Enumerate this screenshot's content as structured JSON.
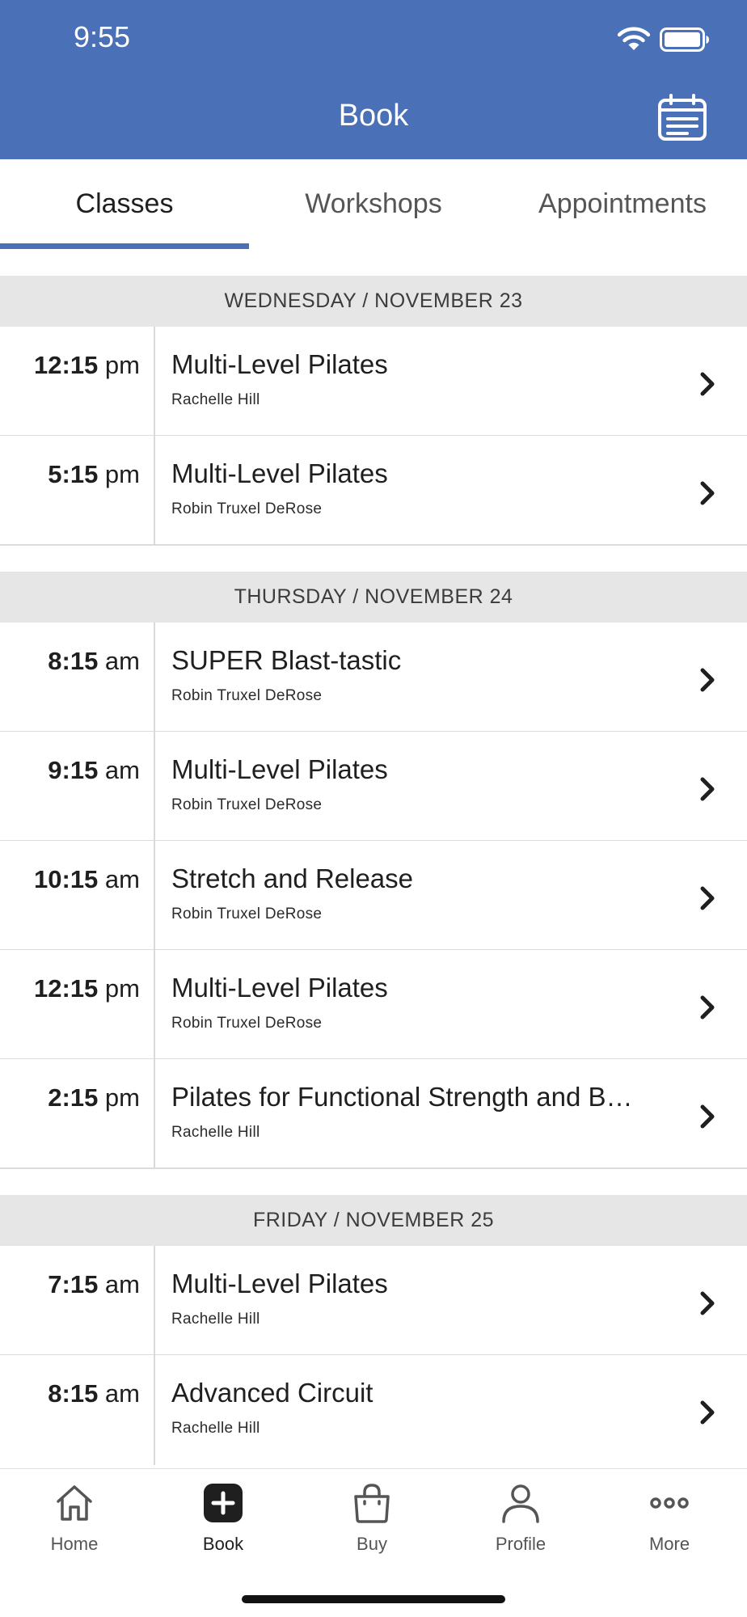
{
  "status_bar": {
    "time": "9:55"
  },
  "header": {
    "title": "Book"
  },
  "tabs": [
    {
      "label": "Classes",
      "active": true
    },
    {
      "label": "Workshops",
      "active": false
    },
    {
      "label": "Appointments",
      "active": false
    }
  ],
  "sections": [
    {
      "header": "WEDNESDAY / NOVEMBER 23",
      "rows": [
        {
          "time": "12:15",
          "ampm": " pm",
          "title": "Multi-Level Pilates",
          "instructor": "Rachelle Hill"
        },
        {
          "time": "5:15",
          "ampm": " pm",
          "title": "Multi-Level Pilates",
          "instructor": "Robin Truxel DeRose"
        }
      ]
    },
    {
      "header": "THURSDAY / NOVEMBER 24",
      "rows": [
        {
          "time": "8:15",
          "ampm": " am",
          "title": "SUPER Blast-tastic",
          "instructor": "Robin Truxel DeRose"
        },
        {
          "time": "9:15",
          "ampm": " am",
          "title": "Multi-Level Pilates",
          "instructor": "Robin Truxel DeRose"
        },
        {
          "time": "10:15",
          "ampm": " am",
          "title": "Stretch and Release",
          "instructor": "Robin Truxel DeRose"
        },
        {
          "time": "12:15",
          "ampm": " pm",
          "title": "Multi-Level Pilates",
          "instructor": "Robin Truxel DeRose"
        },
        {
          "time": "2:15",
          "ampm": " pm",
          "title": "Pilates for Functional Strength and B…",
          "instructor": "Rachelle Hill"
        }
      ]
    },
    {
      "header": "FRIDAY / NOVEMBER 25",
      "rows": [
        {
          "time": "7:15",
          "ampm": " am",
          "title": "Multi-Level Pilates",
          "instructor": "Rachelle Hill"
        },
        {
          "time": "8:15",
          "ampm": " am",
          "title": "Advanced Circuit",
          "instructor": "Rachelle Hill"
        }
      ]
    }
  ],
  "bottom_nav": [
    {
      "label": "Home",
      "icon": "home-icon",
      "active": false
    },
    {
      "label": "Book",
      "icon": "book-plus-icon",
      "active": true
    },
    {
      "label": "Buy",
      "icon": "shopping-bag-icon",
      "active": false
    },
    {
      "label": "Profile",
      "icon": "profile-icon",
      "active": false
    },
    {
      "label": "More",
      "icon": "more-icon",
      "active": false
    }
  ],
  "colors": {
    "brand": "#4a70b7",
    "section_bg": "#e6e6e6",
    "text": "#1f1f1f"
  }
}
